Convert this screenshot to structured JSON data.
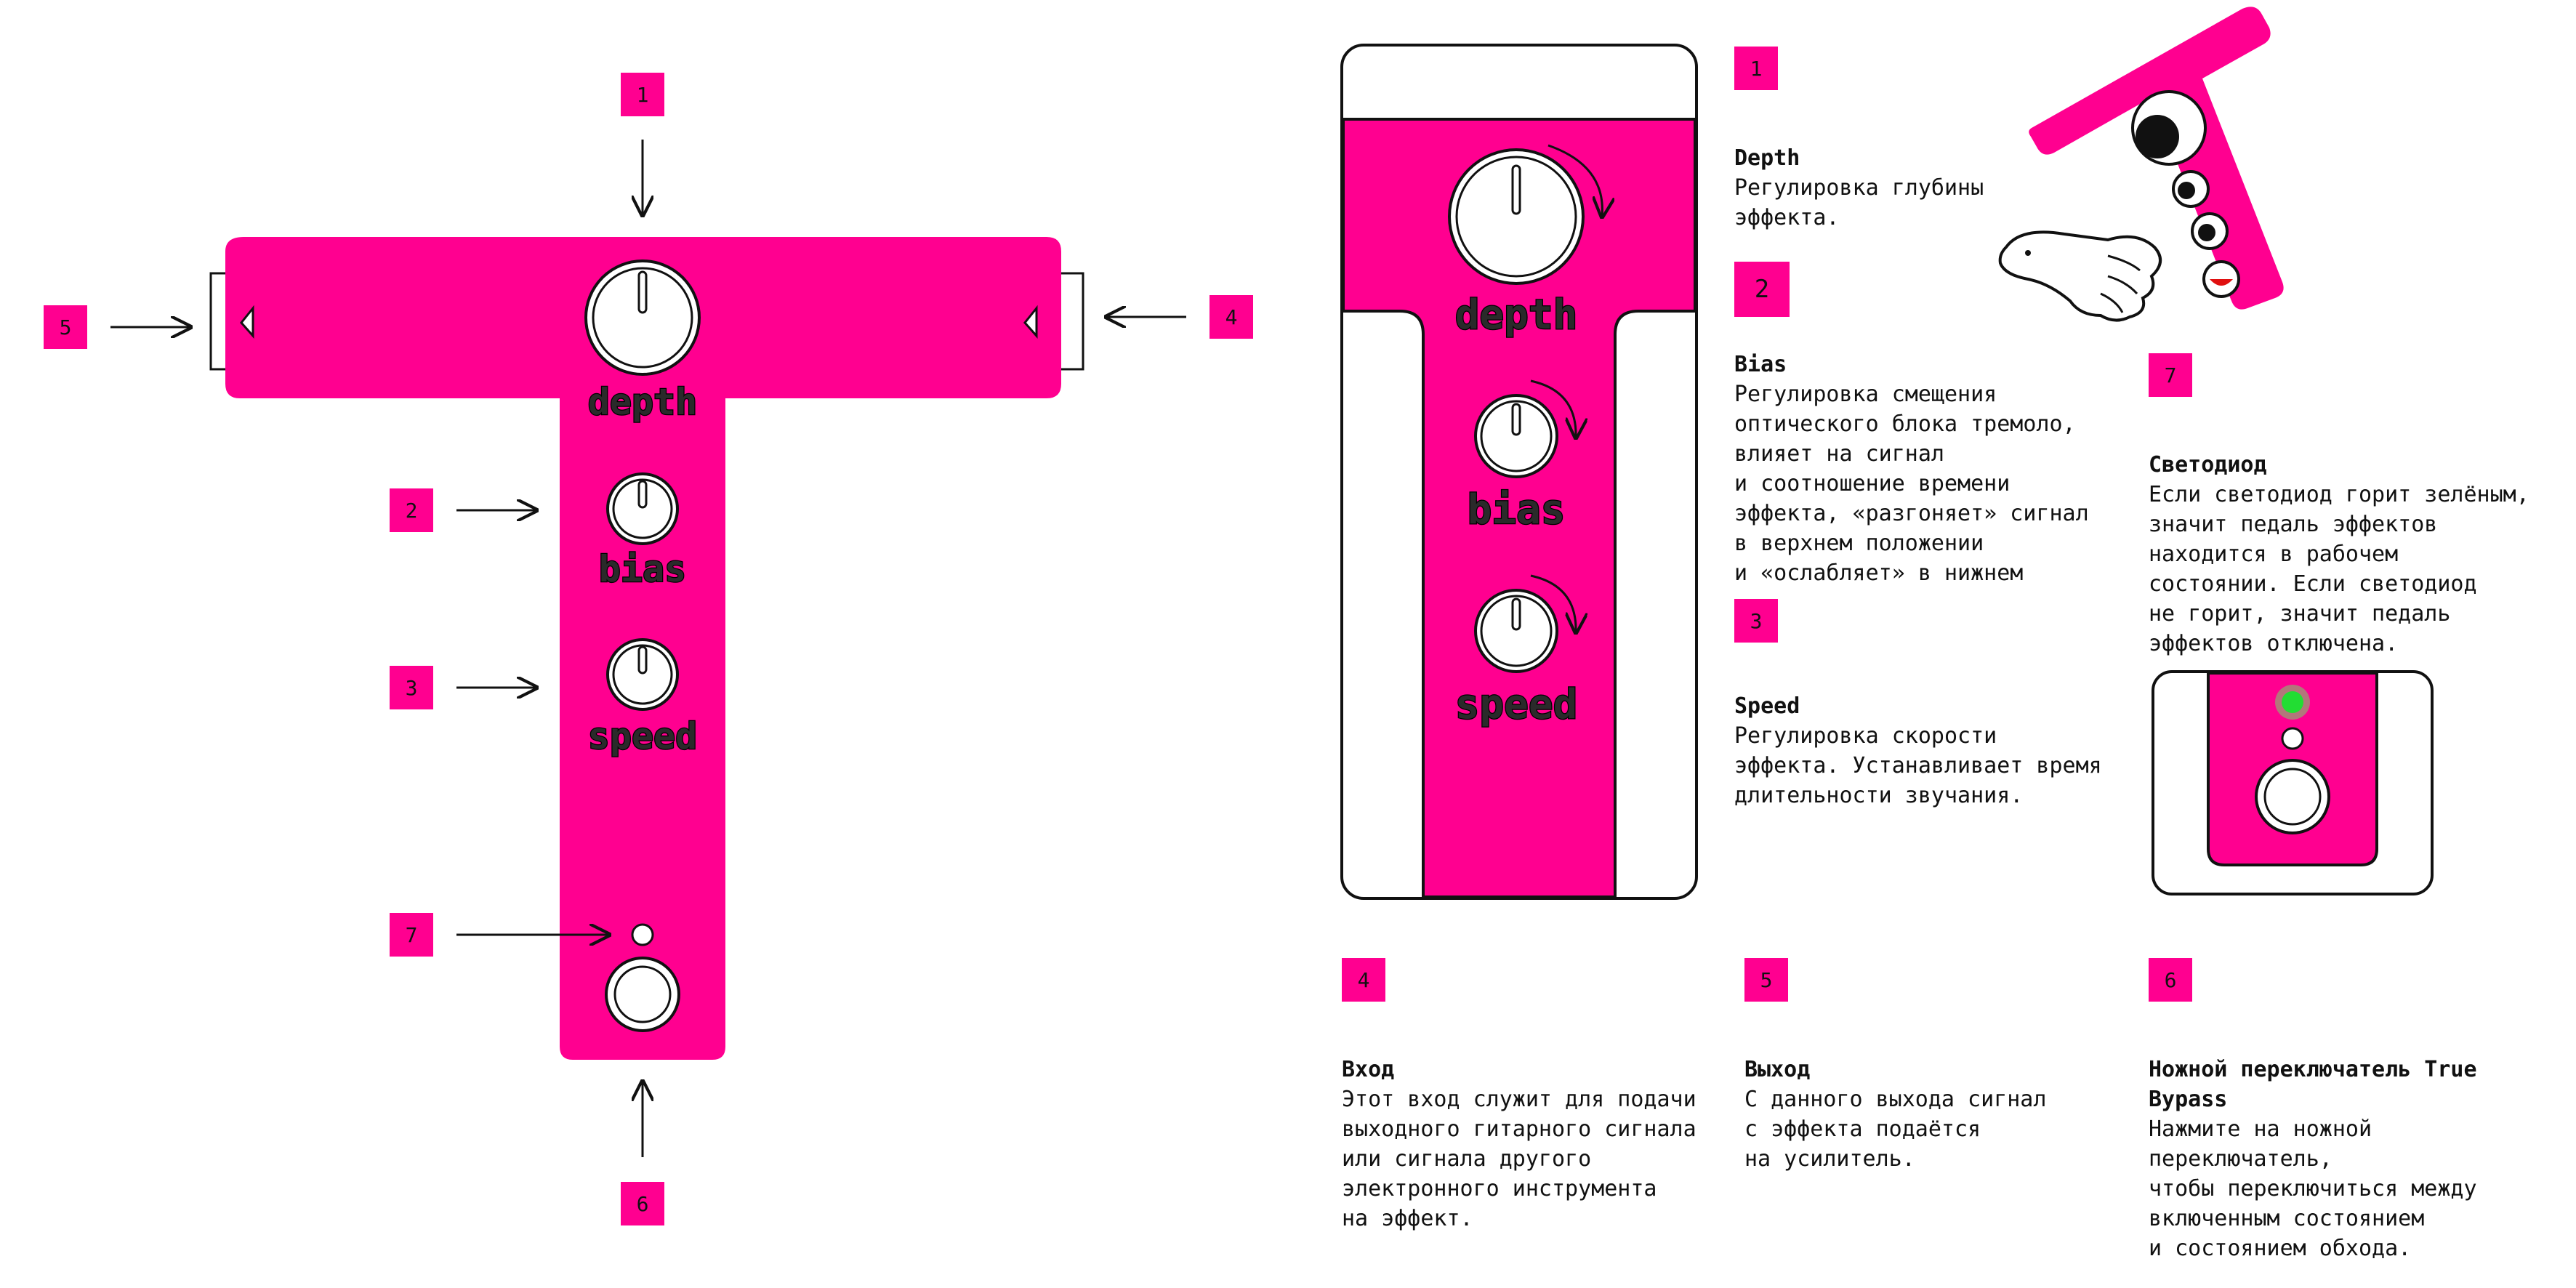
{
  "colors": {
    "accent": "#ff0090",
    "led": "#22dd33",
    "ink": "#111111"
  },
  "diagram": {
    "knobs": [
      "depth",
      "bias",
      "speed"
    ],
    "badges": [
      "1",
      "2",
      "3",
      "7",
      "5",
      "4",
      "6"
    ]
  },
  "sections": [
    {
      "num": "1",
      "title": "Depth",
      "text": "Регулировка глубины\nэффекта."
    },
    {
      "num": "2",
      "title": "Bias",
      "text": "Регулировка смещения\nоптического блока тремоло,\nвлияет на сигнал\nи соотношение времени\nэффекта, «разгоняет» сигнал\nв верхнем положении\nи «ослабляет» в нижнем"
    },
    {
      "num": "3",
      "title": "Speed",
      "text": "Регулировка скорости\nэффекта. Устанавливает время\nдлительности звучания."
    },
    {
      "num": "7",
      "title": "Светодиод",
      "text": "Если светодиод горит зелёным,\nзначит педаль эффектов\nнаходится в рабочем\nсостоянии. Если светодиод\nне горит, значит педаль\nэффектов отключена."
    },
    {
      "num": "4",
      "title": "Вход",
      "text": "Этот вход служит для подачи\nвыходного гитарного сигнала\nили сигнала другого\nэлектронного инструмента\nна эффект."
    },
    {
      "num": "5",
      "title": "Выход",
      "text": "С данного выхода сигнал\nс эффекта подаётся\nна усилитель."
    },
    {
      "num": "6",
      "title": "Ножной переключатель True\nBypass",
      "text": "Нажмите на ножной\nпереключатель,\nчтобы переключиться между\nвключенным состоянием\nи состоянием обхода."
    }
  ]
}
